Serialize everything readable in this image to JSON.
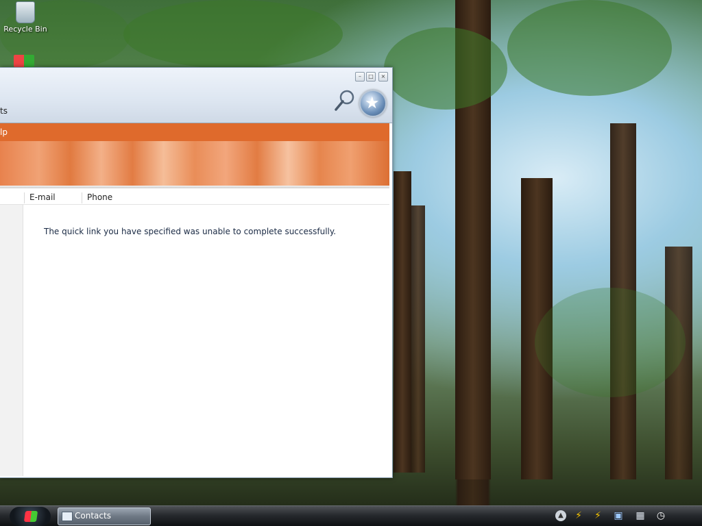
{
  "desktop": {
    "icons": [
      {
        "label": "Recycle Bin",
        "icon": "recycle-bin-icon"
      }
    ]
  },
  "window": {
    "title_partial": "ts",
    "controls": [
      "minimize",
      "maximize",
      "close"
    ],
    "menu_partial": "lp",
    "columns": [
      "E-mail",
      "Phone"
    ],
    "message": "The quick link you have specified was unable to complete successfully."
  },
  "taskbar": {
    "start_icon": "windows-start-icon",
    "task_button_label": "Contacts",
    "tray_icons": [
      "tray-arrow-icon",
      "tray-lightning-icon",
      "tray-lightning-icon-2",
      "tray-network-icon",
      "tray-monitor-icon",
      "tray-clock-icon"
    ]
  },
  "colors": {
    "menubar": "#df6a2c",
    "banner": "#e8824d",
    "taskbar": "#26292d"
  }
}
